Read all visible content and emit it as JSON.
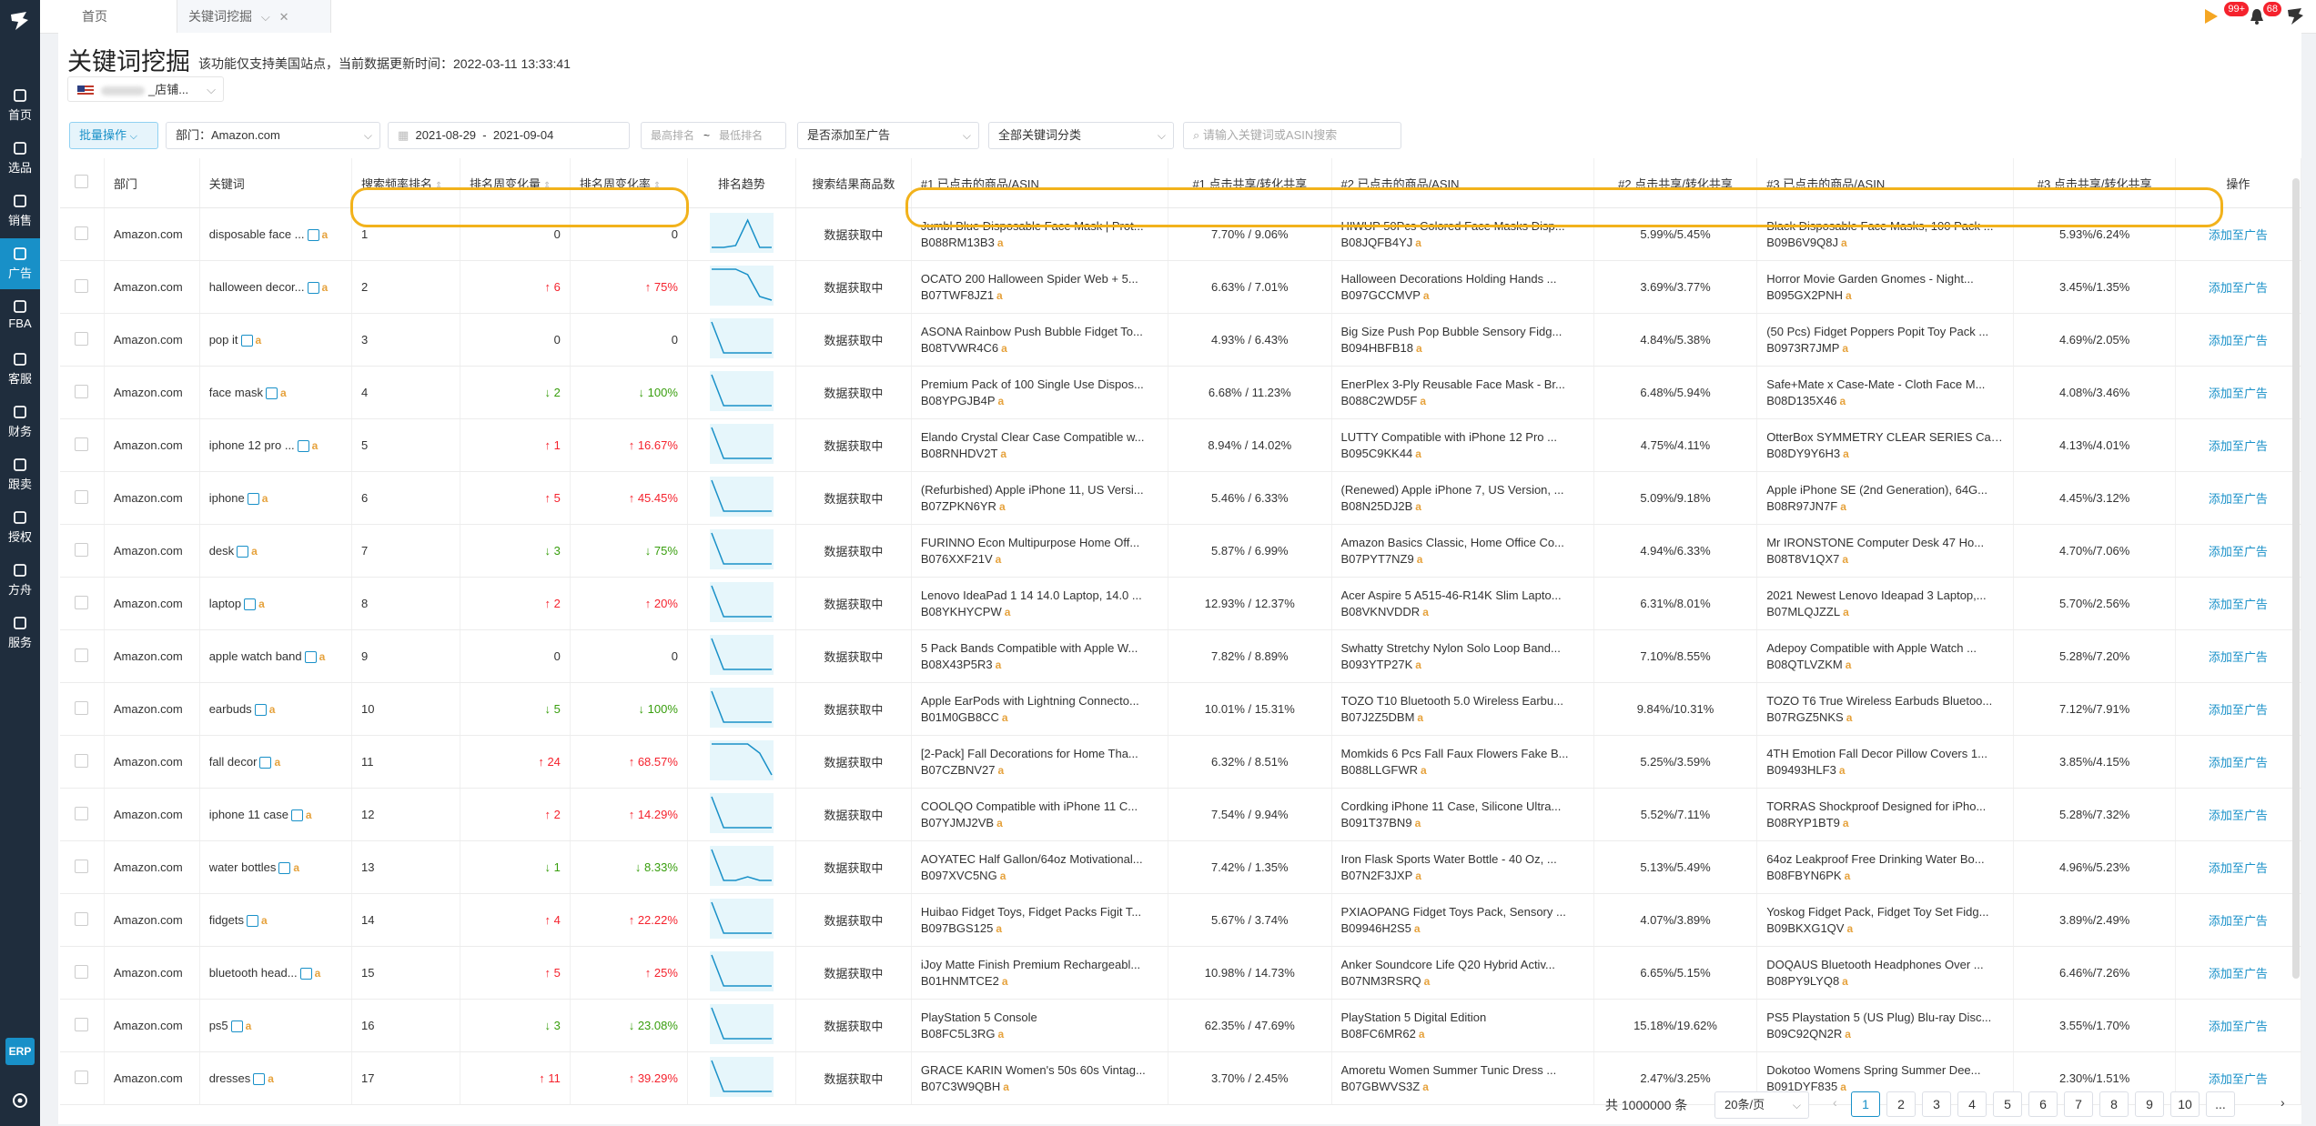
{
  "nav": {
    "items": [
      {
        "label": "首页"
      },
      {
        "label": "选品"
      },
      {
        "label": "销售"
      },
      {
        "label": "广告"
      },
      {
        "label": "FBA"
      },
      {
        "label": "客服"
      },
      {
        "label": "财务"
      },
      {
        "label": "跟卖"
      },
      {
        "label": "授权"
      },
      {
        "label": "方舟"
      },
      {
        "label": "服务"
      }
    ],
    "erp_label": "ERP"
  },
  "tabs": [
    {
      "label": "首页"
    },
    {
      "label": "关键词挖掘"
    }
  ],
  "notifications": {
    "count1": "99+",
    "count2": "68"
  },
  "page": {
    "title": "关键词挖掘",
    "subtitle": "该功能仅支持美国站点，当前数据更新时间：2022-03-11 13:33:41",
    "store_suffix": "_店铺..."
  },
  "filters": {
    "batch": "批量操作",
    "department": "部门：Amazon.com",
    "date_start": "2021-08-29",
    "date_sep": "-",
    "date_end": "2021-09-04",
    "rank_min_placeholder": "最高排名",
    "rank_sep": "~",
    "rank_max_placeholder": "最低排名",
    "ad_status": "是否添加至广告",
    "category": "全部关键词分类",
    "search_placeholder": "请输入关键词或ASIN搜索"
  },
  "table": {
    "headers": {
      "dept": "部门",
      "keyword": "关键词",
      "rank": "搜索频率排名",
      "rank_change": "排名周变化量",
      "rank_rate": "排名周变化率",
      "trend": "排名趋势",
      "results": "搜索结果商品数",
      "p1": "#1 已点击的商品/ASIN",
      "s1": "#1 点击共享/转化共享",
      "p2": "#2 已点击的商品/ASIN",
      "s2": "#2 点击共享/转化共享",
      "p3": "#3 已点击的商品/ASIN",
      "s3": "#3 点击共享/转化共享",
      "op": "操作"
    },
    "fetching_text": "数据获取中",
    "action_text": "添加至广告",
    "rows": [
      {
        "dept": "Amazon.com",
        "kw": "disposable face ...",
        "rank": "1",
        "chg": "0",
        "chg_dir": "",
        "rate": "0",
        "p1": "Jumbl Blue Disposable Face Mask | Prot...",
        "a1": "B088RM13B3",
        "s1": "7.70% / 9.06%",
        "p2": "HIWUP 50Pcs Colored Face Masks Disp...",
        "a2": "B08JQFB4YJ",
        "s2": "5.99%/5.45%",
        "p3": "Black Disposable Face Masks, 100 Pack ...",
        "a3": "B09B6V9Q8J",
        "s3": "5.93%/6.24%"
      },
      {
        "dept": "Amazon.com",
        "kw": "halloween decor...",
        "rank": "2",
        "chg": "6",
        "chg_dir": "up",
        "rate": "75%",
        "p1": "OCATO 200 Halloween Spider Web + 5...",
        "a1": "B07TWF8JZ1",
        "s1": "6.63% / 7.01%",
        "p2": "Halloween Decorations Holding Hands ...",
        "a2": "B097GCCMVP",
        "s2": "3.69%/3.77%",
        "p3": "Horror Movie Garden Gnomes - Night...",
        "a3": "B095GX2PNH",
        "s3": "3.45%/1.35%"
      },
      {
        "dept": "Amazon.com",
        "kw": "pop it",
        "rank": "3",
        "chg": "0",
        "chg_dir": "",
        "rate": "0",
        "p1": "ASONA Rainbow Push Bubble Fidget To...",
        "a1": "B08TVWR4C6",
        "s1": "4.93% / 6.43%",
        "p2": "Big Size Push Pop Bubble Sensory Fidg...",
        "a2": "B094HBFB18",
        "s2": "4.84%/5.38%",
        "p3": "(50 Pcs) Fidget Poppers Popit Toy Pack ...",
        "a3": "B0973R7JMP",
        "s3": "4.69%/2.05%"
      },
      {
        "dept": "Amazon.com",
        "kw": "face mask",
        "rank": "4",
        "chg": "2",
        "chg_dir": "down",
        "rate": "100%",
        "p1": "Premium Pack of 100 Single Use Dispos...",
        "a1": "B08YPGJB4P",
        "s1": "6.68% / 11.23%",
        "p2": "EnerPlex 3-Ply Reusable Face Mask - Br...",
        "a2": "B088C2WD5F",
        "s2": "6.48%/5.94%",
        "p3": "Safe+Mate x Case-Mate - Cloth Face M...",
        "a3": "B08D135X46",
        "s3": "4.08%/3.46%"
      },
      {
        "dept": "Amazon.com",
        "kw": "iphone 12 pro ...",
        "rank": "5",
        "chg": "1",
        "chg_dir": "up",
        "rate": "16.67%",
        "p1": "Elando Crystal Clear Case Compatible w...",
        "a1": "B08RNHDV2T",
        "s1": "8.94% / 14.02%",
        "p2": "LUTTY Compatible with iPhone 12 Pro ...",
        "a2": "B095C9KK44",
        "s2": "4.75%/4.11%",
        "p3": "OtterBox SYMMETRY CLEAR SERIES Cas...",
        "a3": "B08DY9Y6H3",
        "s3": "4.13%/4.01%"
      },
      {
        "dept": "Amazon.com",
        "kw": "iphone",
        "rank": "6",
        "chg": "5",
        "chg_dir": "up",
        "rate": "45.45%",
        "p1": "(Refurbished) Apple iPhone 11, US Versi...",
        "a1": "B07ZPKN6YR",
        "s1": "5.46% / 6.33%",
        "p2": "(Renewed) Apple iPhone 7, US Version, ...",
        "a2": "B08N25DJ2B",
        "s2": "5.09%/9.18%",
        "p3": "Apple iPhone SE (2nd Generation), 64G...",
        "a3": "B08R97JN7F",
        "s3": "4.45%/3.12%"
      },
      {
        "dept": "Amazon.com",
        "kw": "desk",
        "rank": "7",
        "chg": "3",
        "chg_dir": "down",
        "rate": "75%",
        "p1": "FURINNO Econ Multipurpose Home Off...",
        "a1": "B076XXF21V",
        "s1": "5.87% / 6.99%",
        "p2": "Amazon Basics Classic, Home Office Co...",
        "a2": "B07PYT7NZ9",
        "s2": "4.94%/6.33%",
        "p3": "Mr IRONSTONE Computer Desk 47 Ho...",
        "a3": "B08T8V1QX7",
        "s3": "4.70%/7.06%"
      },
      {
        "dept": "Amazon.com",
        "kw": "laptop",
        "rank": "8",
        "chg": "2",
        "chg_dir": "up",
        "rate": "20%",
        "p1": "Lenovo IdeaPad 1 14 14.0 Laptop, 14.0 ...",
        "a1": "B08YKHYCPW",
        "s1": "12.93% / 12.37%",
        "p2": "Acer Aspire 5 A515-46-R14K Slim Lapto...",
        "a2": "B08VKNVDDR",
        "s2": "6.31%/8.01%",
        "p3": "2021 Newest Lenovo Ideapad 3 Laptop,...",
        "a3": "B07MLQJZZL",
        "s3": "5.70%/2.56%"
      },
      {
        "dept": "Amazon.com",
        "kw": "apple watch band",
        "rank": "9",
        "chg": "0",
        "chg_dir": "",
        "rate": "0",
        "p1": "5 Pack Bands Compatible with Apple W...",
        "a1": "B08X43P5R3",
        "s1": "7.82% / 8.89%",
        "p2": "Swhatty Stretchy Nylon Solo Loop Band...",
        "a2": "B093YTP27K",
        "s2": "7.10%/8.55%",
        "p3": "Adepoy Compatible with Apple Watch ...",
        "a3": "B08QTLVZKM",
        "s3": "5.28%/7.20%"
      },
      {
        "dept": "Amazon.com",
        "kw": "earbuds",
        "rank": "10",
        "chg": "5",
        "chg_dir": "down",
        "rate": "100%",
        "p1": "Apple EarPods with Lightning Connecto...",
        "a1": "B01M0GB8CC",
        "s1": "10.01% / 15.31%",
        "p2": "TOZO T10 Bluetooth 5.0 Wireless Earbu...",
        "a2": "B07J2Z5DBM",
        "s2": "9.84%/10.31%",
        "p3": "TOZO T6 True Wireless Earbuds Bluetoo...",
        "a3": "B07RGZ5NKS",
        "s3": "7.12%/7.91%"
      },
      {
        "dept": "Amazon.com",
        "kw": "fall decor",
        "rank": "11",
        "chg": "24",
        "chg_dir": "up",
        "rate": "68.57%",
        "p1": "[2-Pack] Fall Decorations for Home Tha...",
        "a1": "B07CZBNV27",
        "s1": "6.32% / 8.51%",
        "p2": "Momkids 6 Pcs Fall Faux Flowers Fake B...",
        "a2": "B088LLGFWR",
        "s2": "5.25%/3.59%",
        "p3": "4TH Emotion Fall Decor Pillow Covers 1...",
        "a3": "B09493HLF3",
        "s3": "3.85%/4.15%"
      },
      {
        "dept": "Amazon.com",
        "kw": "iphone 11 case",
        "rank": "12",
        "chg": "2",
        "chg_dir": "up",
        "rate": "14.29%",
        "p1": "COOLQO Compatible with iPhone 11 C...",
        "a1": "B07YJMJ2VB",
        "s1": "7.54% / 9.94%",
        "p2": "Cordking iPhone 11 Case, Silicone Ultra...",
        "a2": "B091T37BN9",
        "s2": "5.52%/7.11%",
        "p3": "TORRAS Shockproof Designed for iPho...",
        "a3": "B08RYP1BT9",
        "s3": "5.28%/7.32%"
      },
      {
        "dept": "Amazon.com",
        "kw": "water bottles",
        "rank": "13",
        "chg": "1",
        "chg_dir": "down",
        "rate": "8.33%",
        "p1": "AOYATEC Half Gallon/64oz Motivational...",
        "a1": "B097XVC5NG",
        "s1": "7.42% / 1.35%",
        "p2": "Iron Flask Sports Water Bottle - 40 Oz, ...",
        "a2": "B07N2F3JXP",
        "s2": "5.13%/5.49%",
        "p3": "64oz Leakproof Free Drinking Water Bo...",
        "a3": "B08FBYN6PK",
        "s3": "4.96%/5.23%"
      },
      {
        "dept": "Amazon.com",
        "kw": "fidgets",
        "rank": "14",
        "chg": "4",
        "chg_dir": "up",
        "rate": "22.22%",
        "p1": "Huibao Fidget Toys, Fidget Packs Figit T...",
        "a1": "B097BGS125",
        "s1": "5.67% / 3.74%",
        "p2": "PXIAOPANG Fidget Toys Pack, Sensory ...",
        "a2": "B09946H2S5",
        "s2": "4.07%/3.89%",
        "p3": "Yoskog Fidget Pack, Fidget Toy Set Fidg...",
        "a3": "B09BKXG1QV",
        "s3": "3.89%/2.49%"
      },
      {
        "dept": "Amazon.com",
        "kw": "bluetooth head...",
        "rank": "15",
        "chg": "5",
        "chg_dir": "up",
        "rate": "25%",
        "p1": "iJoy Matte Finish Premium Rechargeabl...",
        "a1": "B01HNMTCE2",
        "s1": "10.98% / 14.73%",
        "p2": "Anker Soundcore Life Q20 Hybrid Activ...",
        "a2": "B07NM3RSRQ",
        "s2": "6.65%/5.15%",
        "p3": "DOQAUS Bluetooth Headphones Over ...",
        "a3": "B08PY9LYQ8",
        "s3": "6.46%/7.26%"
      },
      {
        "dept": "Amazon.com",
        "kw": "ps5",
        "rank": "16",
        "chg": "3",
        "chg_dir": "down",
        "rate": "23.08%",
        "p1": "PlayStation 5 Console",
        "a1": "B08FC5L3RG",
        "s1": "62.35% / 47.69%",
        "p2": "PlayStation 5 Digital Edition",
        "a2": "B08FC6MR62",
        "s2": "15.18%/19.62%",
        "p3": "PS5 Playstation 5 (US Plug) Blu-ray Disc...",
        "a3": "B09C92QN2R",
        "s3": "3.55%/1.70%"
      },
      {
        "dept": "Amazon.com",
        "kw": "dresses",
        "rank": "17",
        "chg": "11",
        "chg_dir": "up",
        "rate": "39.29%",
        "p1": "GRACE KARIN Women's 50s 60s Vintag...",
        "a1": "B07C3W9QBH",
        "s1": "3.70% / 2.45%",
        "p2": "Amoretu Women Summer Tunic Dress ...",
        "a2": "B07GBWVS3Z",
        "s2": "2.47%/3.25%",
        "p3": "Dokotoo Womens Spring Summer Dee...",
        "a3": "B091DYF835",
        "s3": "2.30%/1.51%"
      }
    ]
  },
  "trend": [
    [
      0.1,
      0.1,
      0.15,
      0.85,
      0.1,
      0.1
    ],
    [
      0.95,
      0.95,
      0.95,
      0.8,
      0.2,
      0.1
    ],
    [
      0.95,
      0.1,
      0.1,
      0.1,
      0.1,
      0.1
    ],
    [
      0.95,
      0.1,
      0.1,
      0.1,
      0.1,
      0.1
    ],
    [
      0.95,
      0.1,
      0.1,
      0.1,
      0.1,
      0.1
    ],
    [
      0.95,
      0.1,
      0.1,
      0.1,
      0.1,
      0.1
    ],
    [
      0.95,
      0.1,
      0.1,
      0.1,
      0.1,
      0.1
    ],
    [
      0.95,
      0.1,
      0.1,
      0.1,
      0.1,
      0.1
    ],
    [
      0.95,
      0.1,
      0.1,
      0.1,
      0.1,
      0.1
    ],
    [
      0.95,
      0.1,
      0.1,
      0.1,
      0.1,
      0.1
    ],
    [
      0.95,
      0.95,
      0.95,
      0.95,
      0.7,
      0.1
    ],
    [
      0.95,
      0.1,
      0.1,
      0.1,
      0.1,
      0.1
    ],
    [
      0.95,
      0.1,
      0.1,
      0.2,
      0.1,
      0.1
    ],
    [
      0.95,
      0.1,
      0.1,
      0.1,
      0.1,
      0.1
    ],
    [
      0.95,
      0.1,
      0.1,
      0.1,
      0.1,
      0.1
    ],
    [
      0.95,
      0.1,
      0.1,
      0.1,
      0.1,
      0.1
    ],
    [
      0.95,
      0.1,
      0.1,
      0.1,
      0.1,
      0.1
    ]
  ],
  "pagination": {
    "total": "共 1000000 条",
    "page_size": "20条/页",
    "pages": [
      "1",
      "2",
      "3",
      "4",
      "5",
      "6",
      "7",
      "8",
      "9",
      "10",
      "..."
    ],
    "current": "1"
  },
  "colors": {
    "accent": "#1890c8",
    "highlight": "#f2b21b",
    "up": "#f5222d",
    "down": "#389e0d"
  }
}
